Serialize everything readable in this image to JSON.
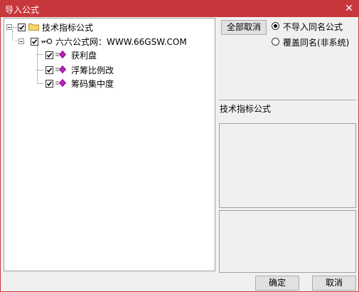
{
  "window": {
    "title": "导入公式",
    "close_glyph": "✕"
  },
  "tree": {
    "root": {
      "label": "技术指标公式",
      "checked": true,
      "icon": "folder-icon"
    },
    "group": {
      "label": "六六公式网：WWW.66GSW.COM",
      "checked": true,
      "icon": "key-icon"
    },
    "items": [
      {
        "label": "获利盘",
        "checked": true,
        "icon": "formula-icon"
      },
      {
        "label": "浮筹比例改",
        "checked": true,
        "icon": "formula-icon"
      },
      {
        "label": "筹码集中度",
        "checked": true,
        "icon": "formula-icon"
      }
    ]
  },
  "right_panel": {
    "cancel_all_label": "全部取消",
    "radio_options": [
      {
        "label": "不导入同名公式",
        "selected": true
      },
      {
        "label": "覆盖同名(非系统)",
        "selected": false
      }
    ],
    "info_label": "技术指标公式"
  },
  "footer": {
    "ok_label": "确定",
    "cancel_label": "取消"
  },
  "colors": {
    "titlebar": "#c8373b",
    "folder": "#f5d66b",
    "formula": "#c020c0"
  }
}
